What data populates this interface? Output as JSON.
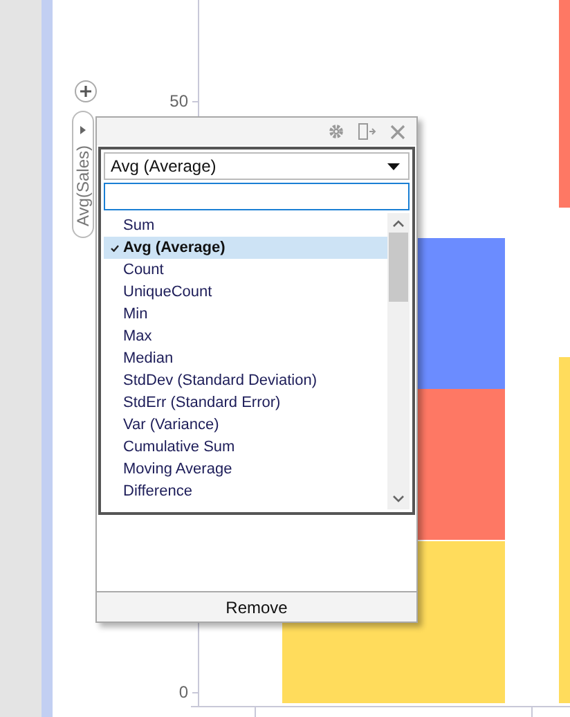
{
  "axis_title": "Avg(Sales)",
  "y_ticks": [
    "50",
    "0"
  ],
  "popup": {
    "dropdown": {
      "value": "Avg (Average)"
    },
    "search": {
      "focused": true
    },
    "items": [
      {
        "label": "Sum",
        "selected": false
      },
      {
        "label": "Avg (Average)",
        "selected": true
      },
      {
        "label": "Count",
        "selected": false
      },
      {
        "label": "UniqueCount",
        "selected": false
      },
      {
        "label": "Min",
        "selected": false
      },
      {
        "label": "Max",
        "selected": false
      },
      {
        "label": "Median",
        "selected": false
      },
      {
        "label": "StdDev (Standard Deviation)",
        "selected": false
      },
      {
        "label": "StdErr (Standard Error)",
        "selected": false
      },
      {
        "label": "Var (Variance)",
        "selected": false
      },
      {
        "label": "Cumulative Sum",
        "selected": false
      },
      {
        "label": "Moving Average",
        "selected": false
      },
      {
        "label": "Difference",
        "selected": false
      }
    ],
    "footer_button": "Remove"
  }
}
